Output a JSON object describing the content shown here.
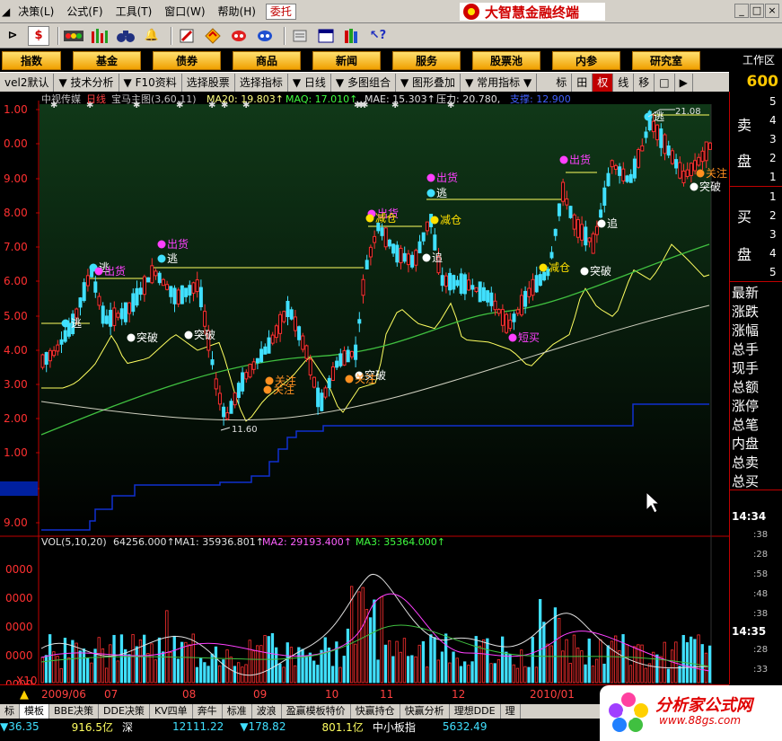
{
  "menu": {
    "items": [
      "决策(L)",
      "公式(F)",
      "工具(T)",
      "窗口(W)",
      "帮助(H)"
    ],
    "trust": "委托",
    "brand": "大智慧金融终端",
    "win_controls": [
      "_",
      "□",
      "×"
    ]
  },
  "toolbar": {
    "icons": [
      "back-icon",
      "dollar-icon",
      "signal-icon",
      "bars-icon",
      "binoculars-icon",
      "bell-icon",
      "export-icon",
      "diamond-icon",
      "candy-icon",
      "phone-icon",
      "note-icon",
      "window-icon",
      "books-icon",
      "help-icon"
    ]
  },
  "navbar": {
    "buttons": [
      "指数",
      "基金",
      "债券",
      "商品",
      "新闻",
      "服务",
      "股票池",
      "内参",
      "研究室"
    ],
    "work_area": "工作区"
  },
  "subbar": {
    "items": [
      "vel2默认",
      "技术分析",
      "F10资料",
      "选择股票",
      "选择指标",
      "日线",
      "多图组合",
      "图形叠加",
      "常用指标"
    ],
    "right_items": [
      "标",
      "田",
      "权",
      "线",
      "移",
      "□",
      "▶"
    ],
    "code": "600"
  },
  "chart": {
    "title": "中视传媒 日线 宝马主图(3,60,11)",
    "stock": "中视传媒",
    "period": "日线",
    "indicator": "宝马主图(3,60,11)",
    "ma20": "MA20: 19.803↑",
    "maq": "MAQ: 17.010↑",
    "mae": "MAE: 15.303↑",
    "pressure": "压力: 20.780,",
    "support": "支撑: 12.900",
    "y_ticks": [
      "1.00",
      "0.00",
      "9.00",
      "8.00",
      "7.00",
      "6.00",
      "5.00",
      "4.00",
      "3.00",
      "2.00",
      "1.00",
      "02",
      "9.00"
    ],
    "high_label": "21.08",
    "low_label": "11.60",
    "signals": [
      {
        "text": "逃",
        "color": "#ffffff"
      },
      {
        "text": "出货",
        "color": "#ff40ff"
      },
      {
        "text": "突破",
        "color": "#ffffff"
      },
      {
        "text": "关注",
        "color": "#ff9020"
      },
      {
        "text": "减仓",
        "color": "#ffe000"
      },
      {
        "text": "追",
        "color": "#ffffff"
      },
      {
        "text": "短买",
        "color": "#ff40ff"
      }
    ]
  },
  "volume": {
    "title": "VOL(5,10,20)",
    "value": "64256.000↑",
    "ma1": "MA1: 35936.801↑",
    "ma2": "MA2: 29193.400↑",
    "ma3": "MA3: 35364.000↑",
    "y_ticks": [
      "0000",
      "0000",
      "0000",
      "0000",
      "0000",
      "0000"
    ],
    "x10": "X10"
  },
  "dates": [
    "2009/06",
    "07",
    "08",
    "09",
    "10",
    "11",
    "12",
    "2010/01"
  ],
  "right_panel": {
    "sell_label_1": "卖",
    "sell_label_2": "盘",
    "buy_label_1": "买",
    "buy_label_2": "盘",
    "sell_nums": [
      "5",
      "4",
      "3",
      "2",
      "1"
    ],
    "buy_nums": [
      "1",
      "2",
      "3",
      "4",
      "5"
    ],
    "fields": [
      "最新",
      "涨跌",
      "涨幅",
      "总手",
      "现手",
      "总额",
      "涨停",
      "总笔",
      "内盘",
      "总卖",
      "总买"
    ],
    "time1": "14:34",
    "minutes1": [
      ":38",
      ":28",
      ":58",
      ":48",
      ":38"
    ],
    "time2": "14:35",
    "minutes2": [
      ":28",
      ":33"
    ]
  },
  "statusbar": {
    "tabs": [
      "标",
      "模板",
      "BBE决策",
      "DDE决策",
      "KV四单",
      "奔牛",
      "标准",
      "波浪",
      "盈赢模板特价",
      "快赢持仓",
      "快赢分析",
      "理想DDE",
      "理"
    ],
    "quote": [
      "▼36.35",
      "916.5亿",
      "深",
      "12111.22",
      "▼178.82",
      "801.1亿",
      "中小板指",
      "5632.49"
    ]
  },
  "watermark": {
    "title": "分析家公式网",
    "url": "www.88gs.com"
  },
  "colors": {
    "up": "#ff3030",
    "down": "#40e0ff",
    "ma_yellow": "#ffff60",
    "ma_green": "#40c040",
    "ma_white": "#d0d0c0",
    "support_blue": "#1030d0",
    "grid": "#c00000"
  }
}
